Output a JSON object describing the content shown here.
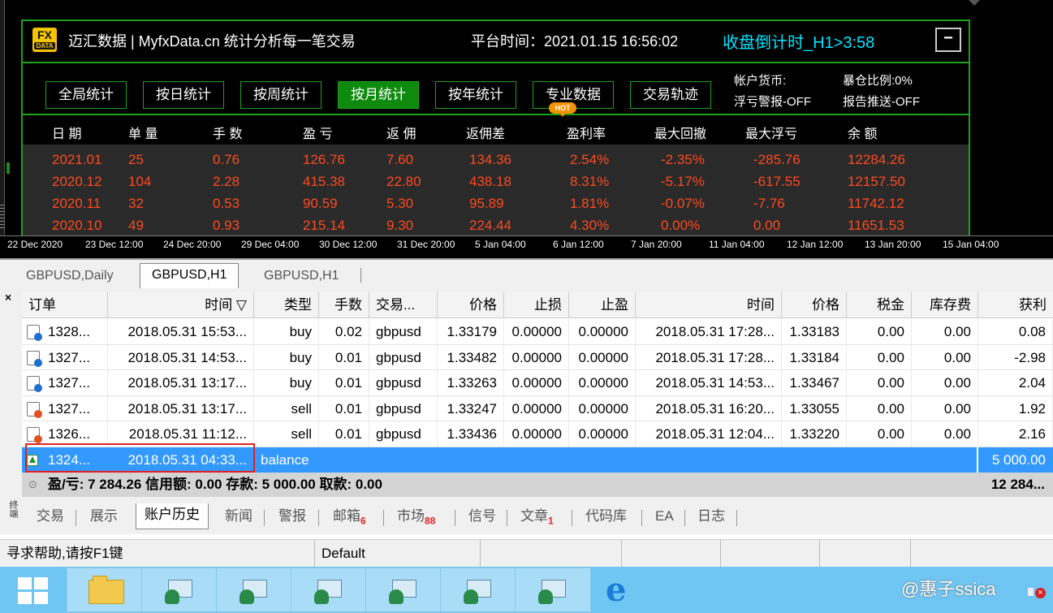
{
  "panel": {
    "logo_top": "FX",
    "logo_bottom": "DATA",
    "brand": "迈汇数据 | MyfxData.cn  统计分析每一笔交易",
    "platform_time": "平台时间：2021.01.15 16:56:02",
    "countdown": "收盘倒计时_H1>3:58",
    "minimize_label": "−",
    "nav": [
      "全局统计",
      "按日统计",
      "按周统计",
      "按月统计",
      "按年统计",
      "专业数据",
      "交易轨迹"
    ],
    "nav_active": 3,
    "hot_badge": "HOT",
    "info": {
      "currency": "帐户货币:",
      "exposure": "暴仓比例:0%",
      "float_alert": "浮亏警报-OFF",
      "report_push": "报告推送-OFF"
    },
    "columns": [
      "日 期",
      "单 量",
      "手 数",
      "盈 亏",
      "返 佣",
      "返佣差",
      "盈利率",
      "最大回撤",
      "最大浮亏",
      "余 额"
    ],
    "rows": [
      [
        "2021.01",
        "25",
        "0.76",
        "126.76",
        "7.60",
        "134.36",
        "2.54%",
        "-2.35%",
        "-285.76",
        "12284.26"
      ],
      [
        "2020.12",
        "104",
        "2.28",
        "415.38",
        "22.80",
        "438.18",
        "8.31%",
        "-5.17%",
        "-617.55",
        "12157.50"
      ],
      [
        "2020.11",
        "32",
        "0.53",
        "90.59",
        "5.30",
        "95.89",
        "1.81%",
        "-0.07%",
        "-7.76",
        "11742.12"
      ],
      [
        "2020.10",
        "49",
        "0.93",
        "215.14",
        "9.30",
        "224.44",
        "4.30%",
        "0.00%",
        "0.00",
        "11651.53"
      ]
    ]
  },
  "chart": {
    "time_labels": [
      "22 Dec 2020",
      "23 Dec 12:00",
      "24 Dec 20:00",
      "29 Dec 04:00",
      "30 Dec 12:00",
      "31 Dec 20:00",
      "5 Jan 04:00",
      "6 Jan 12:00",
      "7 Jan 20:00",
      "11 Jan 04:00",
      "12 Jan 12:00",
      "13 Jan 20:00",
      "15 Jan 04:00"
    ]
  },
  "symbol_tabs": [
    "GBPUSD,Daily",
    "GBPUSD,H1",
    "GBPUSD,H1"
  ],
  "symbol_tab_active": 1,
  "terminal": {
    "close_glyph": "×",
    "side_label": "终端",
    "headers": [
      "订单",
      "时间 ▽",
      "类型",
      "手数",
      "交易...",
      "价格",
      "止损",
      "止盈",
      "时间",
      "价格",
      "税金",
      "库存费",
      "获利"
    ],
    "rows": [
      {
        "kind": "buy",
        "cells": [
          "1328...",
          "2018.05.31 15:53...",
          "buy",
          "0.02",
          "gbpusd",
          "1.33179",
          "0.00000",
          "0.00000",
          "2018.05.31 17:28...",
          "1.33183",
          "0.00",
          "0.00",
          "0.08"
        ]
      },
      {
        "kind": "buy",
        "cells": [
          "1327...",
          "2018.05.31 14:53...",
          "buy",
          "0.01",
          "gbpusd",
          "1.33482",
          "0.00000",
          "0.00000",
          "2018.05.31 17:28...",
          "1.33184",
          "0.00",
          "0.00",
          "-2.98"
        ]
      },
      {
        "kind": "buy",
        "cells": [
          "1327...",
          "2018.05.31 13:17...",
          "buy",
          "0.01",
          "gbpusd",
          "1.33263",
          "0.00000",
          "0.00000",
          "2018.05.31 14:53...",
          "1.33467",
          "0.00",
          "0.00",
          "2.04"
        ]
      },
      {
        "kind": "sell",
        "cells": [
          "1327...",
          "2018.05.31 13:17...",
          "sell",
          "0.01",
          "gbpusd",
          "1.33247",
          "0.00000",
          "0.00000",
          "2018.05.31 16:20...",
          "1.33055",
          "0.00",
          "0.00",
          "1.92"
        ]
      },
      {
        "kind": "sell",
        "cells": [
          "1326...",
          "2018.05.31 11:12...",
          "sell",
          "0.01",
          "gbpusd",
          "1.33436",
          "0.00000",
          "0.00000",
          "2018.05.31 12:04...",
          "1.33220",
          "0.00",
          "0.00",
          "2.16"
        ]
      },
      {
        "kind": "balance",
        "cells": [
          "1324...",
          "2018.05.31 04:33...",
          "balance",
          "",
          "",
          "",
          "",
          "",
          "",
          "",
          "",
          "",
          "5 000.00"
        ]
      }
    ],
    "summary_icon": "⊙",
    "summary": "盈/亏: 7 284.26  信用额: 0.00  存款: 5 000.00  取款: 0.00",
    "summary_total": "12 284...",
    "bottom_tabs": [
      {
        "label": "交易",
        "badge": ""
      },
      {
        "label": "展示",
        "badge": ""
      },
      {
        "label": "账户历史",
        "badge": ""
      },
      {
        "label": "新闻",
        "badge": ""
      },
      {
        "label": "警报",
        "badge": ""
      },
      {
        "label": "邮箱",
        "badge": "6"
      },
      {
        "label": "市场",
        "badge": "88"
      },
      {
        "label": "信号",
        "badge": ""
      },
      {
        "label": "文章",
        "badge": "1"
      },
      {
        "label": "代码库",
        "badge": ""
      },
      {
        "label": "EA",
        "badge": ""
      },
      {
        "label": "日志",
        "badge": ""
      }
    ],
    "bottom_tab_active": 2
  },
  "status": {
    "help": "寻求帮助,请按F1键",
    "profile": "Default"
  },
  "taskbar": {
    "watermark": "@惠子ssica",
    "items": [
      "windows-start-icon",
      "file-explorer-icon",
      "mt4-terminal-icon",
      "mt4-terminal-icon",
      "mt4-terminal-icon",
      "mt4-terminal-icon",
      "mt4-terminal-icon",
      "mt4-terminal-icon",
      "internet-explorer-icon"
    ]
  },
  "colors": {
    "panel_border": "#1aa31a",
    "panel_values": "#ff4a1f",
    "countdown": "#00e5ff",
    "selected_row": "#3399ff",
    "highlight_box": "#e02020",
    "taskbar": "#6fc6f2"
  }
}
